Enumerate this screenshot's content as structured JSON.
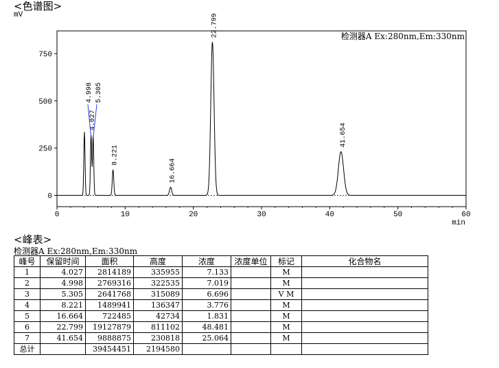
{
  "chromatogram_section": {
    "title": "<色谱图>"
  },
  "peak_table_section": {
    "title": "<峰表>",
    "detector": "检测器A Ex:280nm,Em:330nm"
  },
  "chart_data": {
    "type": "line",
    "detector_label": "检测器A Ex:280nm,Em:330nm",
    "y_unit": "mV",
    "x_unit": "min",
    "xlim": [
      0,
      60
    ],
    "ylim": [
      -60,
      870
    ],
    "x_ticks": [
      0,
      10,
      20,
      30,
      40,
      50,
      60
    ],
    "y_ticks": [
      0,
      250,
      500,
      750
    ],
    "grid": false,
    "peaks": [
      {
        "rt": 4.027,
        "height": 335.955,
        "width": 0.09,
        "label": "4.027"
      },
      {
        "rt": 4.998,
        "height": 322.535,
        "width": 0.09,
        "label": "4.998"
      },
      {
        "rt": 5.305,
        "height": 315.089,
        "width": 0.09,
        "label": "5.305"
      },
      {
        "rt": 8.221,
        "height": 136.347,
        "width": 0.11,
        "label": "8.221"
      },
      {
        "rt": 16.664,
        "height": 42.734,
        "width": 0.16,
        "label": "16.664"
      },
      {
        "rt": 22.799,
        "height": 811.102,
        "width": 0.24,
        "label": "22.799"
      },
      {
        "rt": 41.654,
        "height": 230.818,
        "width": 0.38,
        "label": "41.654"
      }
    ]
  },
  "peak_table": {
    "headers": [
      "峰号",
      "保留时间",
      "面积",
      "高度",
      "浓度",
      "浓度单位",
      "标记",
      "化合物名"
    ],
    "rows": [
      [
        "1",
        "4.027",
        "2814189",
        "335955",
        "7.133",
        "",
        "M",
        ""
      ],
      [
        "2",
        "4.998",
        "2769316",
        "322535",
        "7.019",
        "",
        "M",
        ""
      ],
      [
        "3",
        "5.305",
        "2641768",
        "315089",
        "6.696",
        "",
        "V M",
        ""
      ],
      [
        "4",
        "8.221",
        "1489941",
        "136347",
        "3.776",
        "",
        "M",
        ""
      ],
      [
        "5",
        "16.664",
        "722485",
        "42734",
        "1.831",
        "",
        "M",
        ""
      ],
      [
        "6",
        "22.799",
        "19127879",
        "811102",
        "48.481",
        "",
        "M",
        ""
      ],
      [
        "7",
        "41.654",
        "9888875",
        "230818",
        "25.064",
        "",
        "M",
        ""
      ]
    ],
    "total": [
      "总计",
      "",
      "39454451",
      "2194580",
      "",
      "",
      "",
      ""
    ]
  }
}
